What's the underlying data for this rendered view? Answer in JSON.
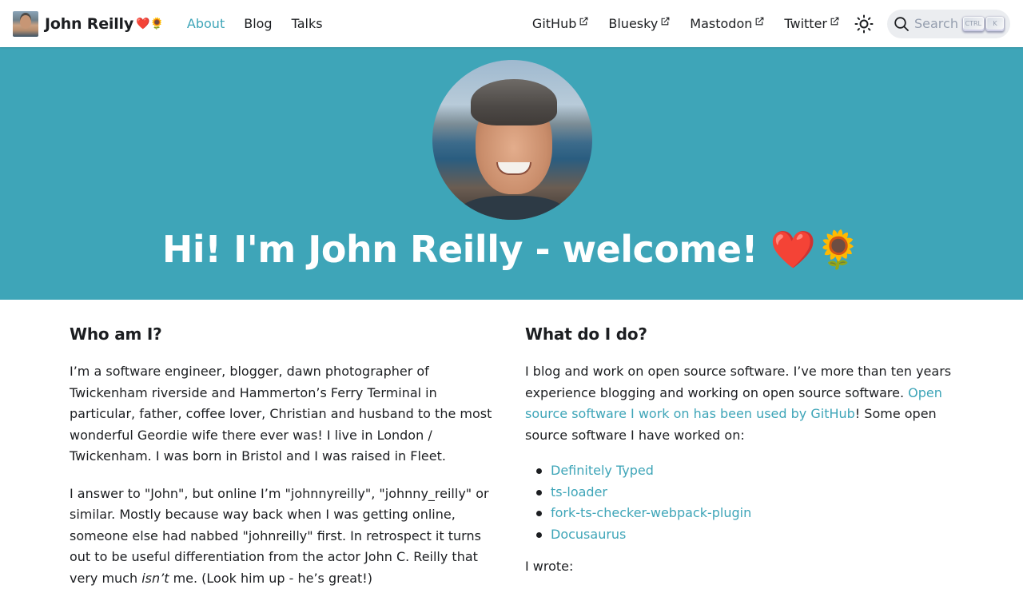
{
  "navbar": {
    "brand_title": "John Reilly",
    "brand_emoji": {
      "heart": "❤️",
      "sun": "🌻"
    },
    "left_links": [
      {
        "label": "About",
        "active": true
      },
      {
        "label": "Blog",
        "active": false
      },
      {
        "label": "Talks",
        "active": false
      }
    ],
    "right_links": [
      {
        "label": "GitHub",
        "external": true
      },
      {
        "label": "Bluesky",
        "external": true
      },
      {
        "label": "Mastodon",
        "external": true
      },
      {
        "label": "Twitter",
        "external": true
      }
    ],
    "theme_toggle_icon": "sun-icon",
    "search": {
      "label": "Search",
      "keys": [
        "CTRL",
        "K"
      ]
    }
  },
  "hero": {
    "title": "Hi! I'm John Reilly - welcome!",
    "emoji": {
      "heart": "❤️",
      "sun": "🌻"
    },
    "background": "#3ea5b8"
  },
  "left_column": {
    "heading": "Who am I?",
    "paragraph1": "I’m a software engineer, blogger, dawn photographer of Twickenham riverside and Hammerton’s Ferry Terminal in particular, father, coffee lover, Christian and husband to the most wonderful Geordie wife there ever was! I live in London / Twickenham. I was born in Bristol and I was raised in Fleet.",
    "paragraph2": {
      "before": "I answer to \"John\", but online I’m \"johnnyreilly\", \"johnny_reilly\" or similar. Mostly because way back when I was getting online, someone else had nabbed \"johnreilly\" first. In retrospect it turns out to be useful differentiation from the actor John C. Reilly that very much ",
      "emphasis": "isn’t",
      "after": " me. (Look him up - he’s great!)"
    }
  },
  "right_column": {
    "heading": "What do I do?",
    "paragraph1": {
      "before": "I blog and work on open source software. I’ve more than ten years experience blogging and working on open source software. ",
      "link": "Open source software I work on has been used by GitHub",
      "after": "! Some open source software I have worked on:"
    },
    "oss_projects": [
      "Definitely Typed",
      "ts-loader",
      "fork-ts-checker-webpack-plugin",
      "Docusaurus"
    ],
    "wrote_label": "I wrote:"
  },
  "colors": {
    "accent": "#3ea5b8",
    "text": "#1c1e21",
    "search_bg": "#ebedf0"
  }
}
